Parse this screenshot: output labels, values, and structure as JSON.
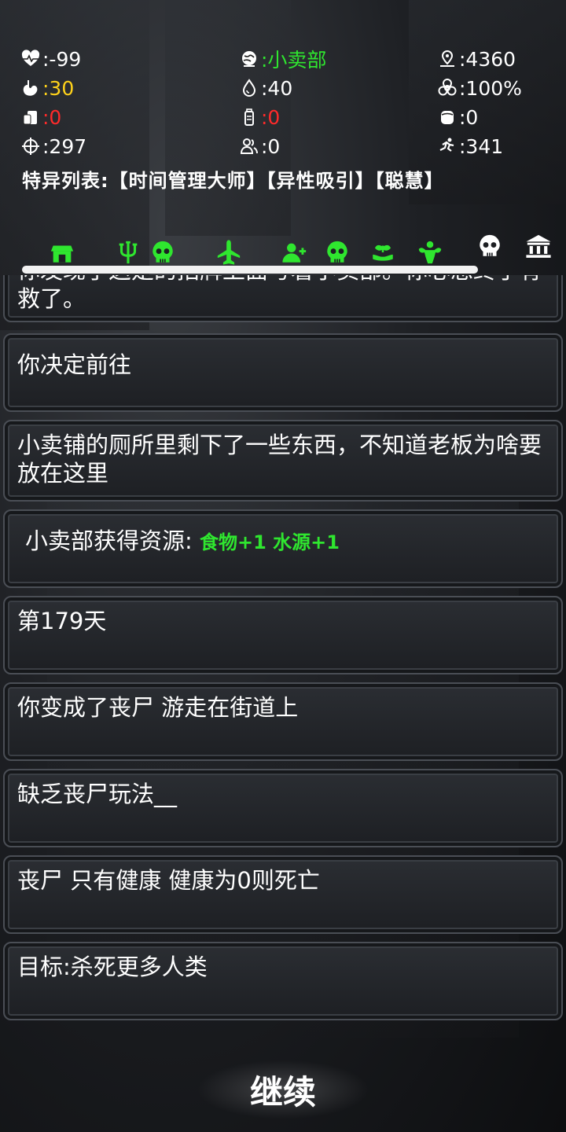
{
  "colors": {
    "green": "#2fe62f",
    "yellow": "#ffd21a",
    "red": "#ff2a2a",
    "white": "#ffffff"
  },
  "stats": [
    {
      "icon": "heartbeat-icon",
      "value": ":-99",
      "color": "#ffffff"
    },
    {
      "icon": "location-globe-icon",
      "value": ":小卖部",
      "color": "#2fe62f"
    },
    {
      "icon": "distance-pin-icon",
      "value": ":4360",
      "color": "#ffffff"
    },
    {
      "icon": "stomach-icon",
      "value": ":30",
      "color": "#ffd21a"
    },
    {
      "icon": "water-drop-icon",
      "value": ":40",
      "color": "#ffffff"
    },
    {
      "icon": "biohazard-icon",
      "value": ":100%",
      "color": "#ffffff"
    },
    {
      "icon": "food-can-icon",
      "value": ":0",
      "color": "#ff2a2a"
    },
    {
      "icon": "water-bottle-icon",
      "value": ":0",
      "color": "#ff2a2a"
    },
    {
      "icon": "meat-icon",
      "value": ":0",
      "color": "#ffffff"
    },
    {
      "icon": "crosshair-icon",
      "value": ":297",
      "color": "#ffffff"
    },
    {
      "icon": "people-icon",
      "value": ":0",
      "color": "#ffffff"
    },
    {
      "icon": "running-man-icon",
      "value": ":341",
      "color": "#ffffff"
    }
  ],
  "traits": "特异列表:【时间管理大师】【异性吸引】【聪慧】",
  "tabs": [
    {
      "icon": "shop-icon",
      "color": "#2fe62f"
    },
    {
      "icon": "trident-icon",
      "color": "#2fe62f"
    },
    {
      "icon": "skull-icon",
      "color": "#2fe62f"
    },
    {
      "icon": "airplane-icon",
      "color": "#2fe62f"
    },
    {
      "icon": "add-user-icon",
      "color": "#2fe62f"
    },
    {
      "icon": "skull-icon",
      "color": "#2fe62f"
    },
    {
      "icon": "plant-hand-icon",
      "color": "#2fe62f"
    },
    {
      "icon": "muscle-man-icon",
      "color": "#2fe62f"
    },
    {
      "icon": "skull-icon",
      "color": "#ffffff"
    },
    {
      "icon": "bank-icon",
      "color": "#ffffff"
    }
  ],
  "log": [
    {
      "text": "你发现了这是的招牌上面写着小卖部。你心想终于有救了。"
    },
    {
      "text": "你决定前往"
    },
    {
      "text": "小卖铺的厕所里剩下了一些东西，不知道老板为啥要放在这里"
    },
    {
      "prefix": "小卖部获得资源: ",
      "resource": "食物+1 水源+1"
    },
    {
      "text": "第179天"
    },
    {
      "text": "你变成了丧尸 游走在街道上"
    },
    {
      "text": "缺乏丧尸玩法__"
    },
    {
      "text": "丧尸 只有健康 健康为0则死亡"
    },
    {
      "text": "目标:杀死更多人类"
    }
  ],
  "continue_label": "继续"
}
